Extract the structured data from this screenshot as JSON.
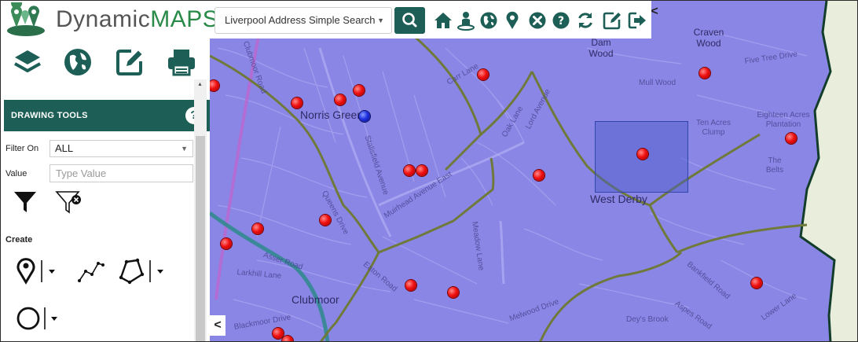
{
  "header": {
    "brand_part1": "Dynamic",
    "brand_part2": "MAPS",
    "search_mode": "Liverpool Address Simple Search",
    "toolbar_icons": [
      "home-icon",
      "user-location-icon",
      "globe-icon",
      "location-pin-icon",
      "close-circle-icon",
      "help-icon",
      "refresh-icon",
      "edit-icon",
      "logout-icon"
    ]
  },
  "panel": {
    "top_icons": [
      "layers-icon",
      "globe-icon",
      "edit-icon",
      "print-icon"
    ],
    "drawing_tools_title": "DRAWING TOOLS",
    "help_label": "?",
    "filter_on_label": "Filter On",
    "filter_on_value": "ALL",
    "value_label": "Value",
    "value_placeholder": "Type Value",
    "create_label": "Create"
  },
  "map": {
    "place_labels": [
      "Norris Green",
      "West Derby",
      "Clubmoor",
      "Dam Wood",
      "Craven Wood",
      "Mull Wood",
      "Ten Acres Clump",
      "Eighteen Acres Plantation",
      "The Belts",
      "Dey's Brook"
    ],
    "road_labels": [
      "Stalisfield Avenue",
      "Muirhead Avenue East",
      "Meadow Lane",
      "Eaton Road",
      "Asser Road",
      "Carr Lane",
      "Melwood Drive",
      "Oak Lane",
      "Five Tree Drive",
      "Lord Avenue",
      "Larkhill Lane",
      "Queens Drive",
      "Bankfield Road",
      "Aspes Road",
      "Blackmoor Drive",
      "Clubmoor Road",
      "Lower Lane"
    ],
    "colors": {
      "overlay": "#8a86e6",
      "boundary": "#6f7a3a",
      "markers": "#e01010"
    }
  },
  "ui": {
    "collapse_right": "<",
    "collapse_left": "<"
  }
}
